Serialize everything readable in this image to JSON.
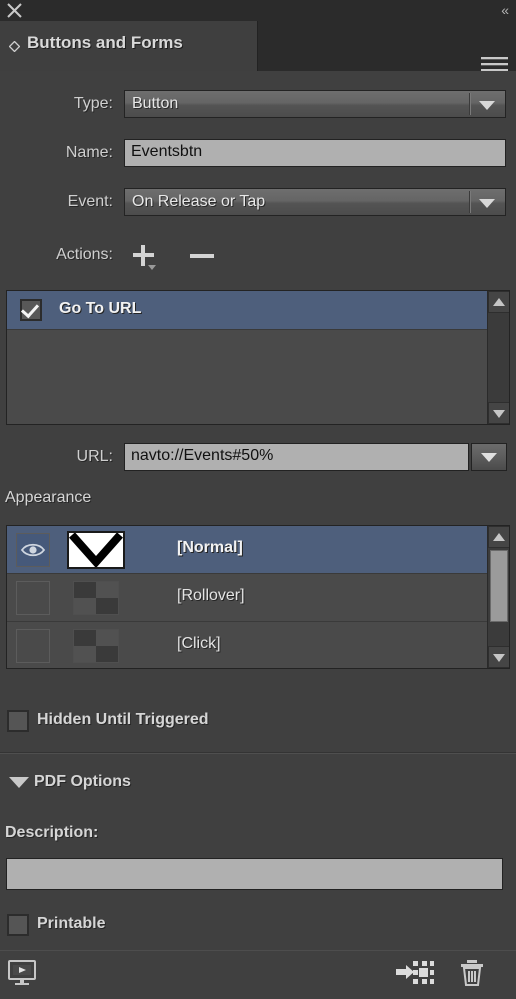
{
  "titlebar": {
    "close_icon": "close-icon",
    "collapse_icon": "double-chevron-left-icon",
    "collapse_glyph": "«"
  },
  "tab": {
    "label": "Buttons and Forms",
    "menu_icon": "panel-menu-icon"
  },
  "fields": {
    "type": {
      "label": "Type:",
      "value": "Button"
    },
    "name": {
      "label": "Name:",
      "value": "Eventsbtn"
    },
    "event": {
      "label": "Event:",
      "value": "On Release or Tap"
    },
    "url": {
      "label": "URL:",
      "value": "navto://Events#50%"
    }
  },
  "actions": {
    "label": "Actions:",
    "add_icon": "plus-icon",
    "remove_icon": "minus-icon",
    "items": [
      {
        "label": "Go To URL",
        "checked": true,
        "selected": true
      }
    ]
  },
  "appearance": {
    "title": "Appearance",
    "states": [
      {
        "label": "[Normal]",
        "visible": true,
        "selected": true,
        "thumb": "artwork"
      },
      {
        "label": "[Rollover]",
        "visible": false,
        "selected": false,
        "thumb": "empty"
      },
      {
        "label": "[Click]",
        "visible": false,
        "selected": false,
        "thumb": "empty"
      }
    ]
  },
  "options": {
    "hidden_until_triggered": {
      "label": "Hidden Until Triggered",
      "checked": false
    },
    "pdf_options": {
      "label": "PDF Options",
      "expanded": true
    },
    "description": {
      "label": "Description:",
      "value": ""
    },
    "printable": {
      "label": "Printable",
      "checked": false
    }
  },
  "bottombar": {
    "preview_icon": "preview-monitor-icon",
    "convert_icon": "convert-to-object-icon",
    "delete_icon": "trash-icon"
  },
  "colors": {
    "panel_bg": "#404040",
    "titlebar_bg": "#2b2b2b",
    "tab_bg": "#3f3f3f",
    "selection": "#4e5f7c",
    "field_bg": "#b0b0b0",
    "text": "#d6d6d6"
  }
}
